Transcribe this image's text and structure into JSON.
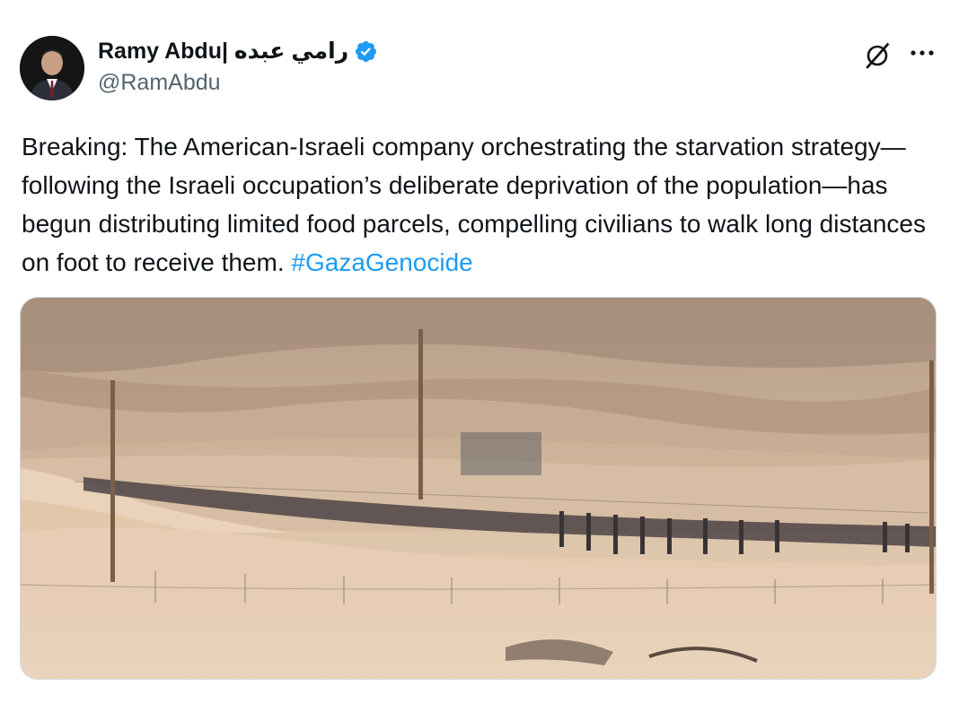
{
  "author": {
    "display_name": "Ramy Abdu| رامي عبده",
    "handle": "@RamAbdu",
    "verified": true,
    "avatar_icon": "profile-photo"
  },
  "actions": {
    "grok_icon": "grok-icon",
    "more_icon": "more-dots-icon"
  },
  "tweet": {
    "text": "Breaking: The American-Israeli company orchestrating the starvation strategy—following the Israeli occupation’s deliberate deprivation of the population—has begun distributing limited food parcels, compelling civilians to walk long distances on foot to receive them. ",
    "hashtag": "#GazaGenocide"
  },
  "media": {
    "type": "photo"
  },
  "colors": {
    "link": "#1d9bf0",
    "verified_badge": "#1d9bf0",
    "secondary_text": "#536471"
  }
}
